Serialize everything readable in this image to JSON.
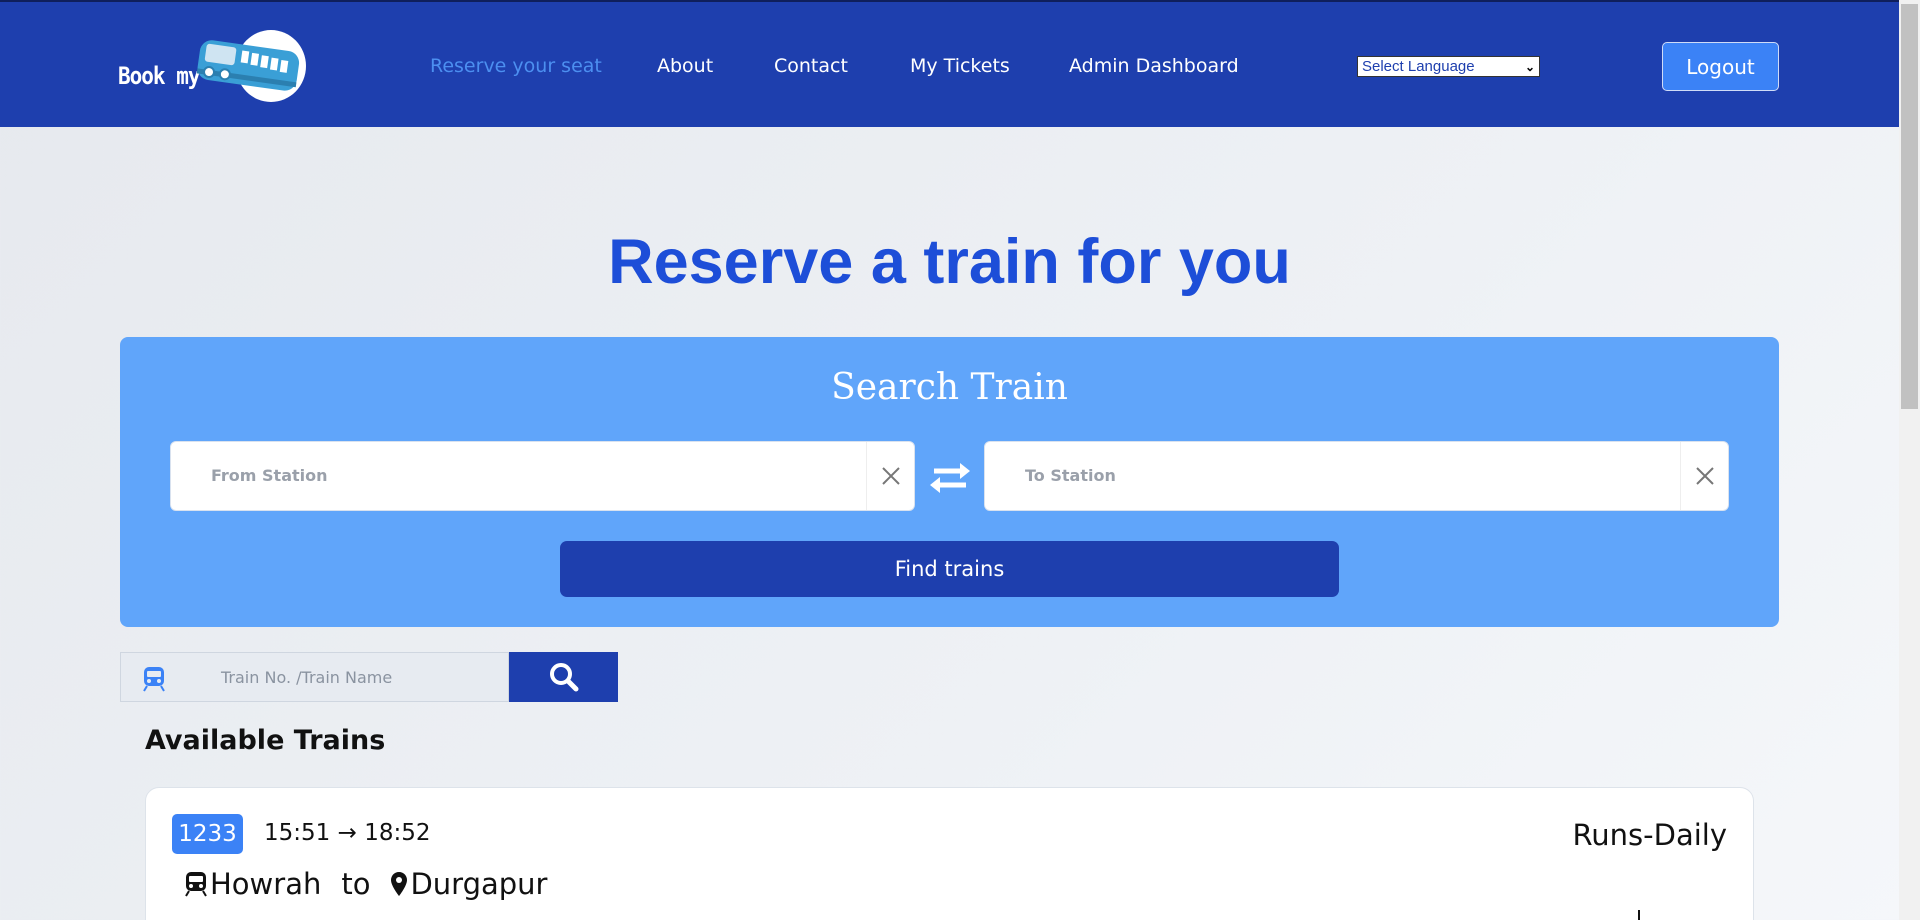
{
  "brand": {
    "logo_text": "Book my"
  },
  "nav": {
    "items": [
      {
        "label": "Reserve your seat",
        "active": true
      },
      {
        "label": "About",
        "active": false
      },
      {
        "label": "Contact",
        "active": false
      },
      {
        "label": "My Tickets",
        "active": false
      },
      {
        "label": "Admin Dashboard",
        "active": false
      }
    ],
    "language_select": {
      "selected": "Select Language"
    },
    "logout_label": "Logout"
  },
  "hero": {
    "title": "Reserve a train for you"
  },
  "search": {
    "title": "Search Train",
    "from_placeholder": "From Station",
    "to_placeholder": "To Station",
    "find_label": "Find trains",
    "train_query_placeholder": "Train No. /Train Name"
  },
  "available": {
    "title": "Available Trains",
    "trains": [
      {
        "number": "1233",
        "depart": "15:51",
        "arrive": "18:52",
        "arrow": "→",
        "runs": "Runs-Daily",
        "from": "Howrah",
        "connector": "to",
        "to": "Durgapur"
      }
    ]
  },
  "colors": {
    "header": "#1e3fae",
    "accent": "#3b82f6",
    "panel": "#60a5fa",
    "hero_title": "#1d4ed8",
    "active_nav": "#4c8ff0"
  }
}
